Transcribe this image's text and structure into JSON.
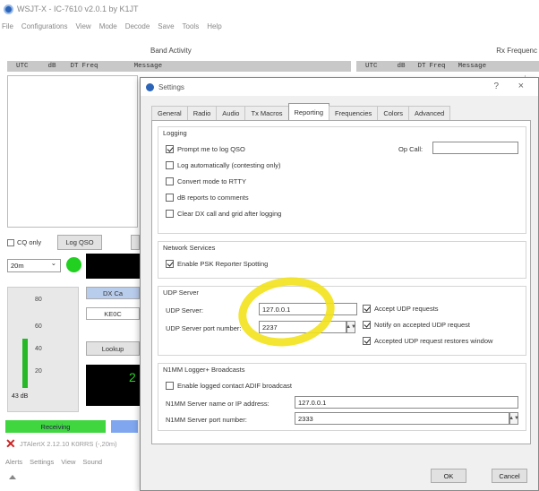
{
  "window": {
    "title": "WSJT-X - IC-7610 v2.0.1 by K1JT",
    "menu": [
      "File",
      "Configurations",
      "View",
      "Mode",
      "Decode",
      "Save",
      "Tools",
      "Help"
    ]
  },
  "main": {
    "band_activity": "Band Activity",
    "rx_frequency": "Rx Frequenc",
    "left_headers": [
      "UTC",
      "dB",
      "DT",
      "Freq",
      "Message"
    ],
    "right_headers": [
      "UTC",
      "dB",
      "DT",
      "Freq",
      "Message"
    ],
    "cq_only": "CQ only",
    "log_qso": "Log QSO",
    "band": "20m",
    "dx_call": "DX Ca",
    "dx_grid": "KE0C",
    "lookup": "Lookup",
    "meter_scale": [
      "80",
      "60",
      "40",
      "20"
    ],
    "meter_db": "43 dB",
    "meter_level_fraction": 0.55,
    "receiving": "Receiving",
    "status_text": "JTAlertX 2.12.10 K0RRS (-,20m)",
    "bottom_menu": [
      "Alerts",
      "Settings",
      "View",
      "Sound"
    ],
    "readout_digit": "2"
  },
  "settings": {
    "title": "Settings",
    "help": "?",
    "close": "×",
    "tabs": [
      "General",
      "Radio",
      "Audio",
      "Tx Macros",
      "Reporting",
      "Frequencies",
      "Colors",
      "Advanced"
    ],
    "active_tab": "Reporting",
    "logging": {
      "title": "Logging",
      "op_call_label": "Op Call:",
      "op_call_value": "",
      "prompt_log": "Prompt me to log QSO",
      "log_auto": "Log automatically (contesting only)",
      "convert_rtty": "Convert mode to RTTY",
      "db_reports": "dB reports to comments",
      "clear_dx": "Clear DX call and grid after logging"
    },
    "network": {
      "title": "Network Services",
      "psk_reporter": "Enable PSK Reporter Spotting"
    },
    "udp": {
      "title": "UDP Server",
      "server_label": "UDP Server:",
      "server_value": "127.0.0.1",
      "port_label": "UDP Server port number:",
      "port_value": "2237",
      "accept": "Accept UDP requests",
      "notify": "Notify on accepted UDP request",
      "restore": "Accepted UDP request restores window"
    },
    "n1mm": {
      "title": "N1MM Logger+ Broadcasts",
      "enable": "Enable logged contact ADIF broadcast",
      "server_label": "N1MM Server name or IP address:",
      "server_value": "127.0.0.1",
      "port_label": "N1MM Server port number:",
      "port_value": "2333"
    },
    "ok": "OK",
    "cancel": "Cancel"
  },
  "colors": {
    "highlight_ellipse": "#f2e21c",
    "receiving_green": "#3fd63f",
    "indicator_green": "#22d022"
  }
}
